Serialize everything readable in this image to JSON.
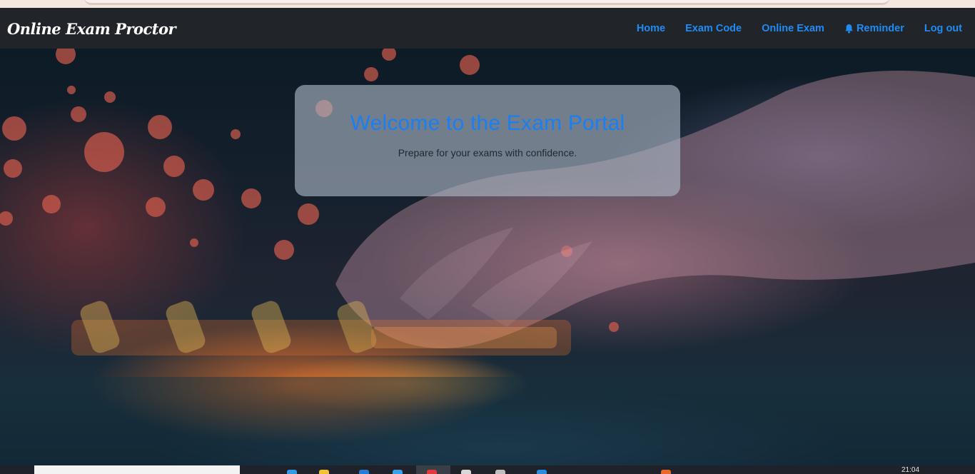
{
  "navbar": {
    "brand": "Online Exam Proctor",
    "links": {
      "home": "Home",
      "exam_code": "Exam Code",
      "online_exam": "Online Exam",
      "reminder": "Reminder",
      "logout": "Log out"
    },
    "reminder_icon": "bell-icon"
  },
  "hero": {
    "title": "Welcome to the Exam Portal",
    "subtitle": "Prepare for your exams with confidence."
  },
  "taskbar": {
    "clock": "21:04"
  },
  "colors": {
    "navbar_bg": "#212529",
    "link": "#1f8bf5",
    "title": "#1a7ff2"
  }
}
